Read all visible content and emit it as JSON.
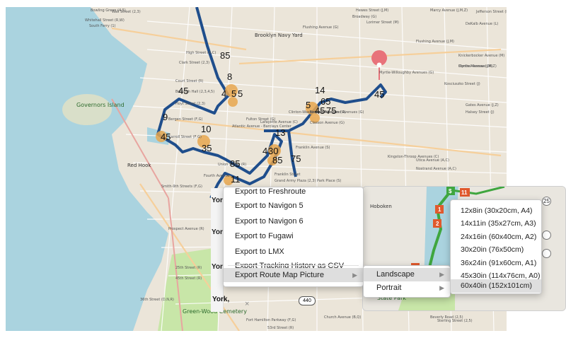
{
  "map": {
    "route_numbers": [
      "85",
      "8",
      "45",
      "4",
      "5",
      "5",
      "65",
      "14",
      "5",
      "45",
      "75",
      "9",
      "10",
      "45",
      "35",
      "13",
      "4",
      "30",
      "85",
      "75",
      "85",
      "11",
      "45",
      "45",
      "85"
    ],
    "labels": {
      "brooklyn_navy_yard": "Brooklyn Navy Yard",
      "governors_island": "Governors Island",
      "red_hook": "Red Hook",
      "hoboken": "Hoboken",
      "state_park": "State Park",
      "green_wood": "Green-Wood Cemetery",
      "street_labels": [
        "Bowling Green (4,5)",
        "Wall Street (2,3)",
        "Whitehall Street (R,W)",
        "South Ferry (1)",
        "High Street (A,C)",
        "Clark Street (2,3)",
        "Court Street (R)",
        "Borough Hall (2,3,4,5)",
        "Hoyt Street (2,3)",
        "Bergen Street (F,G)",
        "Carroll Street (F,G)",
        "Smith-9th Streets (F,G)",
        "Prospect Avenue (R)",
        "25th Street (R)",
        "36th Street (D,N,R)",
        "45th Street (R)",
        "Fulton Street (G)",
        "Atlantic Avenue - Barclays Center",
        "Union Street (R)",
        "Grand Army Plaza (2,3)",
        "Park Place (S)",
        "Franklin Avenue (S)",
        "Kingston-Throop Avenues (C)",
        "Utica Avenue (A,C)",
        "Nostrand Avenue (A,C)",
        "Myrtle-Willoughby Avenues (G)",
        "Flushing Avenue (G)",
        "Lorimer Street (M)",
        "Central Avenue (M)",
        "Kosciuszko Street (J)",
        "Gates Avenue (J,Z)",
        "Halsey Street (J)",
        "Jefferson Street (L)",
        "DeKalb Avenue (L)",
        "Hewes Street (J,M)",
        "Marcy Avenue (J,M,Z)",
        "Broadway (G)",
        "Flushing Avenue (J,M)",
        "Knickerbocker Avenue (M)",
        "Myrtle Avenue (J,M,Z)",
        "Clinton-Washington Avenues (G)",
        "Lafayette Avenue (C)",
        "Classon Avenue (G)",
        "Bedford-Nostrand Avenues (G)",
        "Franklin Street",
        "Church Avenue (B,Q)",
        "Fort Hamilton Parkway (F,G)",
        "Beverly Road (2,5)",
        "Sterling Street (2,5)",
        "Newkirk Avenue",
        "53rd Street (R)",
        "Fourth Avenue",
        "Prospect Park (B,Q,S)",
        "7th Avenue (B,Q)"
      ]
    }
  },
  "context_menu": {
    "items": [
      {
        "label": "Export to Freshroute",
        "has_submenu": false
      },
      {
        "label": "Export to Navigon 5",
        "has_submenu": false
      },
      {
        "label": "Export to Navigon 6",
        "has_submenu": false
      },
      {
        "label": "Export to Fugawi",
        "has_submenu": false
      },
      {
        "label": "Export to LMX",
        "has_submenu": false
      },
      {
        "label": "Export Tracking History as CSV",
        "has_submenu": false
      },
      {
        "label": "Export Route Map Picture",
        "has_submenu": true
      }
    ]
  },
  "orientation_menu": {
    "items": [
      {
        "label": "Landscape",
        "has_submenu": true
      },
      {
        "label": "Portrait",
        "has_submenu": true
      }
    ]
  },
  "size_menu": {
    "items": [
      {
        "label": "12x8in (30x20cm, A4)"
      },
      {
        "label": "14x11in (35x27cm, A3)"
      },
      {
        "label": "24x16in (60x40cm, A2)"
      },
      {
        "label": "30x20in (76x50cm)"
      },
      {
        "label": "36x24in (91x60cm, A1)"
      },
      {
        "label": "45x30in (114x76cm, A0)"
      },
      {
        "label": "60x40in (152x101cm)"
      }
    ]
  },
  "left_panel": {
    "york_labels": [
      "York",
      "York",
      "York",
      "York,"
    ],
    "close_symbol": "×"
  },
  "panel_map": {
    "markers": [
      "$",
      "11",
      "1",
      "2",
      "1",
      "1"
    ],
    "route_badge": "440",
    "highway_badge": "25"
  },
  "colors": {
    "route": "#1f4e8c",
    "marker_pin": "#e8727a",
    "stop_marker": "#e8a74f",
    "menu_highlight": "#dedede",
    "map_background": "#ebe5d9",
    "water": "#aad3df",
    "park": "#c8e6a8"
  }
}
